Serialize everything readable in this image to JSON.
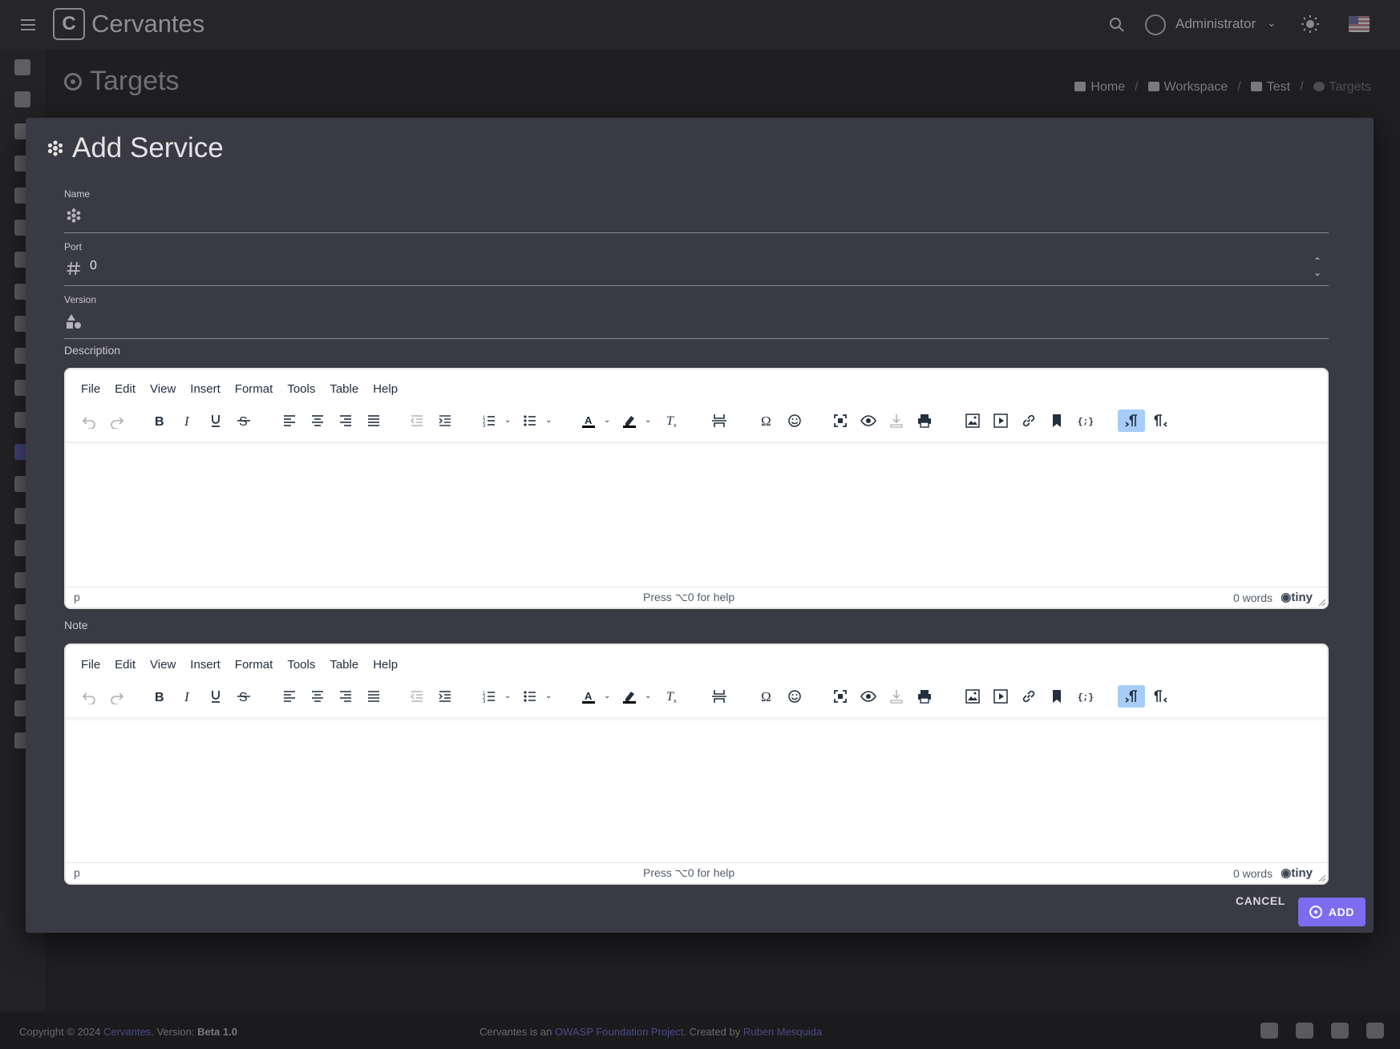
{
  "app": {
    "name": "Cervantes",
    "user": "Administrator"
  },
  "page": {
    "title": "Targets",
    "breadcrumb": [
      "Home",
      "Workspace",
      "Test",
      "Targets"
    ]
  },
  "modal": {
    "title": "Add Service",
    "fields": {
      "name": {
        "label": "Name",
        "value": ""
      },
      "port": {
        "label": "Port",
        "value": "0"
      },
      "version": {
        "label": "Version",
        "value": ""
      }
    },
    "description": {
      "label": "Description",
      "menu": [
        "File",
        "Edit",
        "View",
        "Insert",
        "Format",
        "Tools",
        "Table",
        "Help"
      ],
      "status_path": "p",
      "status_help": "Press ⌥0 for help",
      "status_words": "0 words",
      "brand": "tiny"
    },
    "note": {
      "label": "Note",
      "menu": [
        "File",
        "Edit",
        "View",
        "Insert",
        "Format",
        "Tools",
        "Table",
        "Help"
      ],
      "status_path": "p",
      "status_help": "Press ⌥0 for help",
      "status_words": "0 words",
      "brand": "tiny"
    },
    "buttons": {
      "cancel": "CANCEL",
      "add": "ADD"
    }
  },
  "footer": {
    "copyright": "Copyright © 2024",
    "app_link": "Cervantes",
    "version_label": ". Version:",
    "version": "Beta 1.0",
    "project_prefix": "Cervantes is an",
    "project_link": "OWASP Foundation Project",
    "created_by": ". Created by",
    "author": "Ruben Mesquida"
  },
  "colors": {
    "accent": "#7c6cf0",
    "modal_bg": "#3a3a44",
    "page_bg": "#1f1f22",
    "active_toolbar": "#a6ccf7"
  },
  "toolbar_icons": [
    "undo-icon",
    "redo-icon",
    "bold-icon",
    "italic-icon",
    "underline-icon",
    "strikethrough-icon",
    "align-left-icon",
    "align-center-icon",
    "align-right-icon",
    "align-justify-icon",
    "outdent-icon",
    "indent-icon",
    "numbered-list-icon",
    "bullet-list-icon",
    "text-color-icon",
    "highlight-color-icon",
    "clear-format-icon",
    "page-break-icon",
    "special-char-icon",
    "emoji-icon",
    "fullscreen-icon",
    "preview-icon",
    "save-icon",
    "print-icon",
    "image-icon",
    "media-icon",
    "link-icon",
    "anchor-icon",
    "code-sample-icon",
    "ltr-icon",
    "rtl-icon"
  ]
}
